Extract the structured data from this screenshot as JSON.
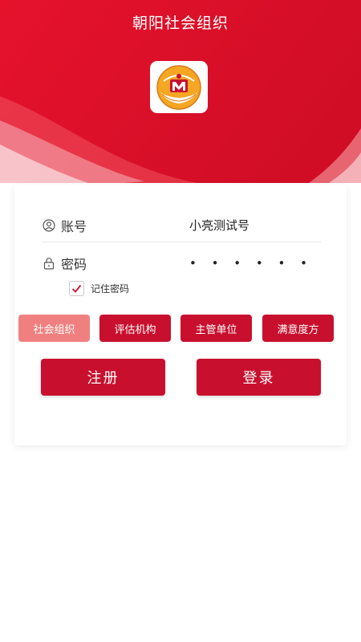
{
  "header": {
    "title": "朝阳社会组织"
  },
  "logo": {
    "icon": "mca-emblem-icon"
  },
  "form": {
    "account_label": "账号",
    "account_value": "小亮测试号",
    "password_label": "密码",
    "password_value": "• • • • • •",
    "remember_label": "记住密码",
    "remember_checked": true
  },
  "roles": [
    {
      "label": "社会组织",
      "active": true
    },
    {
      "label": "评估机构",
      "active": false
    },
    {
      "label": "主管单位",
      "active": false
    },
    {
      "label": "满意度方",
      "active": false
    }
  ],
  "buttons": {
    "register": "注册",
    "login": "登录"
  },
  "colors": {
    "primary": "#c8102e",
    "active_tab": "#f08080",
    "hero": "#e8142d"
  }
}
